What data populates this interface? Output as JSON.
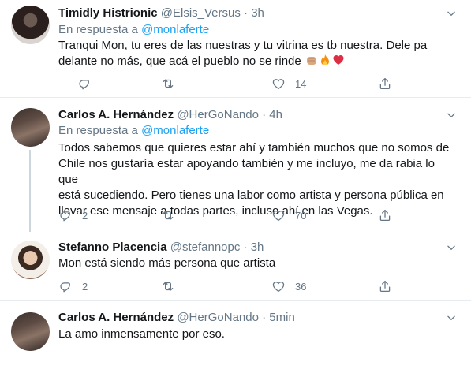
{
  "reply_prefix": "En respuesta a ",
  "tweets": [
    {
      "name": "Timidly Histrionic",
      "handle": "@Elsis_Versus",
      "separator": "·",
      "time": "3h",
      "reply_to": "@monlaferte",
      "text_line1": "Tranqui Mon, tu eres de las nuestras y tu vitrina es tb nuestra. Dele pa",
      "text_line2": "delante no más, que acá el pueblo no se rinde",
      "emojis": [
        "fist-emoji",
        "fire-emoji",
        "heart-emoji"
      ],
      "replies": "",
      "retweets": "",
      "likes": "14"
    },
    {
      "name": "Carlos A. Hernández",
      "handle": "@HerGoNando",
      "separator": "·",
      "time": "4h",
      "reply_to": "@monlaferte",
      "text_lines": [
        "Todos sabemos que quieres estar ahí y también muchos que no somos de",
        "Chile nos gustaría estar apoyando también y me incluyo, me da rabia lo que",
        "está sucediendo. Pero tienes una labor como artista y persona pública en",
        "llevar ese mensaje a todas partes, incluso ahí en las Vegas."
      ],
      "replies": "2",
      "retweets": "",
      "likes": "70"
    },
    {
      "name": "Stefanno Placencia",
      "handle": "@stefannopc",
      "separator": "·",
      "time": "3h",
      "text": "Mon está siendo más persona que artista",
      "replies": "2",
      "retweets": "",
      "likes": "36"
    },
    {
      "name": "Carlos A. Hernández",
      "handle": "@HerGoNando",
      "separator": "·",
      "time": "5min",
      "text": "La amo inmensamente por eso."
    }
  ]
}
